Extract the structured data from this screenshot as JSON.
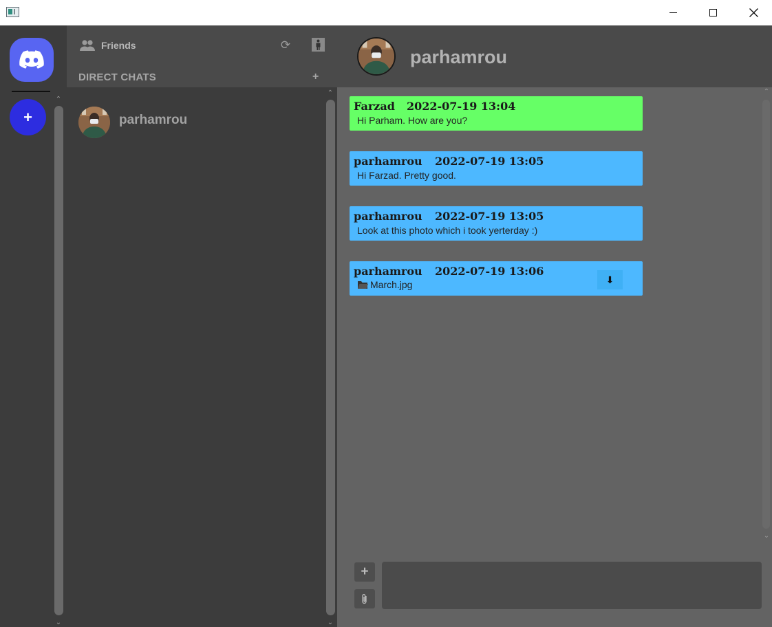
{
  "window": {
    "icon": "app-window-icon",
    "minimize": "minimize-icon",
    "maximize": "maximize-icon",
    "close": "close-icon"
  },
  "rail": {
    "logo_icon": "discord-logo-icon",
    "add_server_label": "+"
  },
  "panel": {
    "friends_label": "Friends",
    "direct_chats_label": "DIRECT CHATS",
    "add_chat_label": "+",
    "chats": [
      {
        "name": "parhamrou"
      }
    ]
  },
  "chat": {
    "title": "parhamrou",
    "messages": [
      {
        "author": "Farzad",
        "time": "2022-07-19 13:04",
        "text": "Hi Parham. How are you?",
        "color": "#66ff66"
      },
      {
        "author": "parhamrou",
        "time": "2022-07-19 13:05",
        "text": "Hi Farzad. Pretty good.",
        "color": "#4db8ff"
      },
      {
        "author": "parhamrou",
        "time": "2022-07-19 13:05",
        "text": "Look at this photo which i took yerterday :)",
        "color": "#4db8ff"
      },
      {
        "author": "parhamrou",
        "time": "2022-07-19 13:06",
        "file": "March.jpg",
        "color": "#4db8ff"
      }
    ],
    "compose": {
      "add_label": "+",
      "attach_icon": "paperclip-icon",
      "placeholder": ""
    }
  },
  "colors": {
    "rail_bg": "#3c3c3c",
    "header_bg": "#4a4a4a",
    "chat_bg": "#636363",
    "accent": "#5865f2",
    "add_server": "#2d2de0",
    "self_message": "#4db8ff",
    "other_message": "#66ff66"
  }
}
